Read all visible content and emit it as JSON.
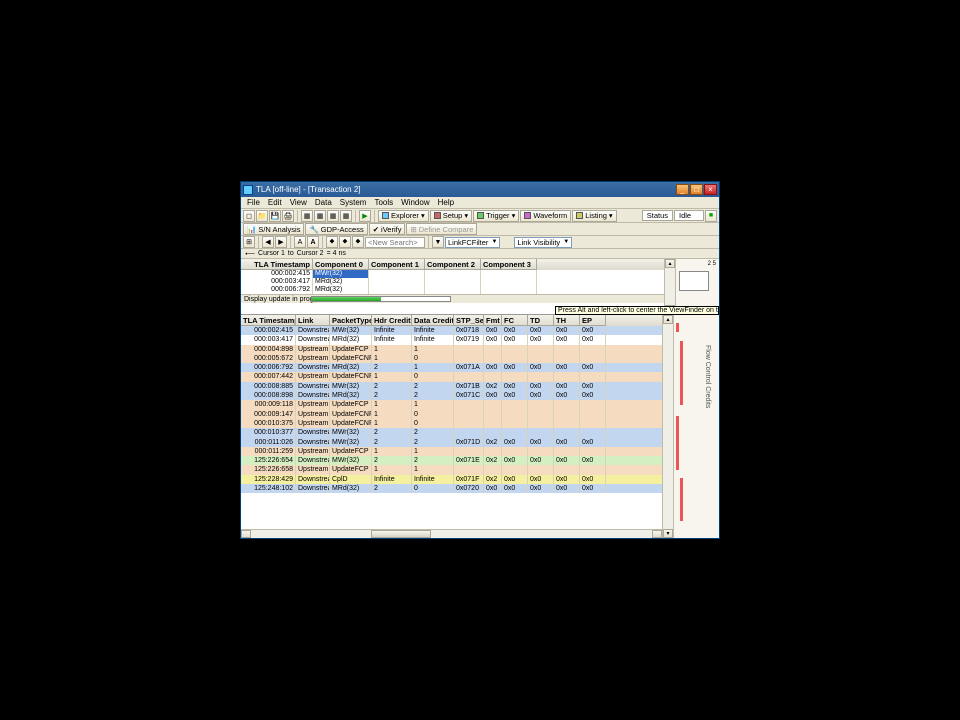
{
  "window": {
    "title": "TLA [off-line] - [Transaction 2]"
  },
  "menubar": [
    "File",
    "Edit",
    "View",
    "Data",
    "System",
    "Tools",
    "Window",
    "Help"
  ],
  "toolbar1": {
    "explorer": "Explorer",
    "setup": "Setup",
    "trigger": "Trigger",
    "waveform": "Waveform",
    "listing": "Listing",
    "status_label": "Status",
    "status_value": "Idle"
  },
  "toolbar2": {
    "sn_analysis": "S/N Analysis",
    "gdp_access": "GDP-Access",
    "verify": "iVerify",
    "define_compare": "Define Compare"
  },
  "toolbar3": {
    "search_placeholder": "<New Search>",
    "filter_label": "LinkFCFilter",
    "visibility_label": "Link Visibility"
  },
  "ruler": {
    "c1": "Cursor 1",
    "to": "to",
    "c2": "Cursor 2",
    "delta": "= 4 ns"
  },
  "comp_table": {
    "columns": [
      "TLA Timestamp",
      "Component 0",
      "Component 1",
      "Component 2",
      "Component 3"
    ],
    "rows": [
      {
        "ts": "000:002:415",
        "c0": "MWr(32)",
        "sel": true
      },
      {
        "ts": "000:003:417",
        "c0": "MRd(32)"
      },
      {
        "ts": "000:006:792",
        "c0": "MRd(32)"
      }
    ],
    "status_text": "Display update in progress..."
  },
  "tooltip": "Press Alt and left-click to center the ViewFinder on this  location.",
  "main_table": {
    "columns": [
      "TLA Timestamp",
      "Link",
      "PacketType",
      "Hdr Credits",
      "Data Credits",
      "STP_Seq",
      "Fmt",
      "FC",
      "TD",
      "TH",
      "EP"
    ],
    "rows": [
      {
        "cls": "blue",
        "ts": "000:002:415",
        "link": "Downstream",
        "pkt": "MWr(32)",
        "hdr": "Infinite",
        "dat": "Infinite",
        "stp": "0x0718",
        "fmt": "0x0",
        "fc": "0x0",
        "td": "0x0",
        "th": "0x0",
        "ep": "0x0"
      },
      {
        "cls": "white",
        "ts": "000:003:417",
        "link": "Downstream",
        "pkt": "MRd(32)",
        "hdr": "Infinite",
        "dat": "Infinite",
        "stp": "0x0719",
        "fmt": "0x0",
        "fc": "0x0",
        "td": "0x0",
        "th": "0x0",
        "ep": "0x0"
      },
      {
        "cls": "peach",
        "ts": "000:004:898",
        "link": "Upstream",
        "pkt": "UpdateFCP",
        "hdr": "1",
        "dat": "1"
      },
      {
        "cls": "peach red",
        "ts": "000:005:672",
        "link": "Upstream",
        "pkt": "UpdateFCNP",
        "hdr": "1",
        "dat": "0"
      },
      {
        "cls": "blue",
        "ts": "000:006:792",
        "link": "Downstream",
        "pkt": "MRd(32)",
        "hdr": "2",
        "dat": "1",
        "stp": "0x071A",
        "fmt": "0x0",
        "fc": "0x0",
        "td": "0x0",
        "th": "0x0",
        "ep": "0x0"
      },
      {
        "cls": "peach red",
        "ts": "000:007:442",
        "link": "Upstream",
        "pkt": "UpdateFCNP",
        "hdr": "1",
        "dat": "0"
      },
      {
        "cls": "blue",
        "ts": "000:008:885",
        "link": "Downstream",
        "pkt": "MWr(32)",
        "hdr": "2",
        "dat": "2",
        "stp": "0x071B",
        "fmt": "0x2",
        "fc": "0x0",
        "td": "0x0",
        "th": "0x0",
        "ep": "0x0"
      },
      {
        "cls": "blue",
        "ts": "000:008:898",
        "link": "Downstream",
        "pkt": "MRd(32)",
        "hdr": "2",
        "dat": "2",
        "stp": "0x071C",
        "fmt": "0x0",
        "fc": "0x0",
        "td": "0x0",
        "th": "0x0",
        "ep": "0x0"
      },
      {
        "cls": "peach",
        "ts": "000:009:118",
        "link": "Upstream",
        "pkt": "UpdateFCP",
        "hdr": "1",
        "dat": "1"
      },
      {
        "cls": "peach red",
        "ts": "000:009:147",
        "link": "Upstream",
        "pkt": "UpdateFCNP",
        "hdr": "1",
        "dat": "0"
      },
      {
        "cls": "peach red",
        "ts": "000:010:375",
        "link": "Upstream",
        "pkt": "UpdateFCNP",
        "hdr": "1",
        "dat": "0"
      },
      {
        "cls": "blue",
        "ts": "000:010:377",
        "link": "Downstream",
        "pkt": "MWr(32)",
        "hdr": "2",
        "dat": "2"
      },
      {
        "cls": "blue",
        "ts": "000:011:026",
        "link": "Downstream",
        "pkt": "MWr(32)",
        "hdr": "2",
        "dat": "2",
        "stp": "0x071D",
        "fmt": "0x2",
        "fc": "0x0",
        "td": "0x0",
        "th": "0x0",
        "ep": "0x0"
      },
      {
        "cls": "peach",
        "ts": "000:011:259",
        "link": "Upstream",
        "pkt": "UpdateFCP",
        "hdr": "1",
        "dat": "1"
      },
      {
        "cls": "green",
        "ts": "125:226:654",
        "link": "Downstream",
        "pkt": "MWr(32)",
        "hdr": "2",
        "dat": "2",
        "stp": "0x071E",
        "fmt": "0x2",
        "fc": "0x0",
        "td": "0x0",
        "th": "0x0",
        "ep": "0x0"
      },
      {
        "cls": "peach",
        "ts": "125:226:658",
        "link": "Upstream",
        "pkt": "UpdateFCP",
        "hdr": "1",
        "dat": "1"
      },
      {
        "cls": "yellow",
        "ts": "125:228:429",
        "link": "Downstream",
        "pkt": "CplD",
        "hdr": "Infinite",
        "dat": "Infinite",
        "stp": "0x071F",
        "fmt": "0x2",
        "fc": "0x0",
        "td": "0x0",
        "th": "0x0",
        "ep": "0x0"
      },
      {
        "cls": "blue",
        "ts": "125:248:102",
        "link": "Downstream",
        "pkt": "MRd(32)",
        "hdr": "2",
        "dat": "0",
        "stp": "0x0720",
        "fmt": "0x0",
        "fc": "0x0",
        "td": "0x0",
        "th": "0x0",
        "ep": "0x0"
      }
    ]
  },
  "right_rail": {
    "title": "Flow Control Credits"
  },
  "minimap": {
    "scale": "2   5"
  }
}
